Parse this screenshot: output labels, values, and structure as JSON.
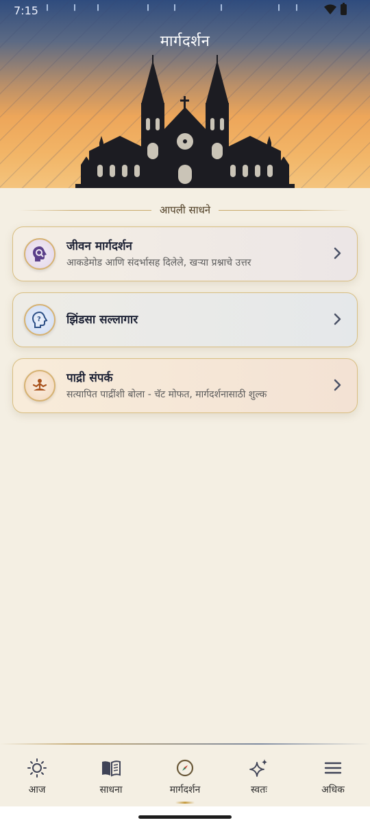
{
  "status_bar": {
    "time": "7:15"
  },
  "header": {
    "title": "मार्गदर्शन"
  },
  "section": {
    "heading": "आपली साधने"
  },
  "cards": [
    {
      "title": "जीवन मार्गदर्शन",
      "subtitle": "आकडेमोड आणि संदर्भासह दिलेले, खऱ्या प्रश्नाचे उत्तर",
      "icon": "head-search-icon"
    },
    {
      "title": "झिंडसा सल्लागार",
      "subtitle": "",
      "icon": "head-question-icon"
    },
    {
      "title": "पाद्री संपर्क",
      "subtitle": "सत्यापित पाद्रींशी बोला - चॅट मोफत, मार्गदर्शनासाठी शुल्क",
      "icon": "meditation-person-icon"
    }
  ],
  "nav": {
    "items": [
      {
        "label": "आज",
        "icon": "sun-icon"
      },
      {
        "label": "साधना",
        "icon": "book-icon"
      },
      {
        "label": "मार्गदर्शन",
        "icon": "compass-icon",
        "active": true
      },
      {
        "label": "स्वतः",
        "icon": "sparkles-icon"
      },
      {
        "label": "अधिक",
        "icon": "menu-icon"
      }
    ]
  },
  "colors": {
    "accent_gold": "#c9a96a",
    "header_top": "#2f4c7e",
    "header_bottom": "#f4c47d",
    "background": "#f4efe3"
  }
}
